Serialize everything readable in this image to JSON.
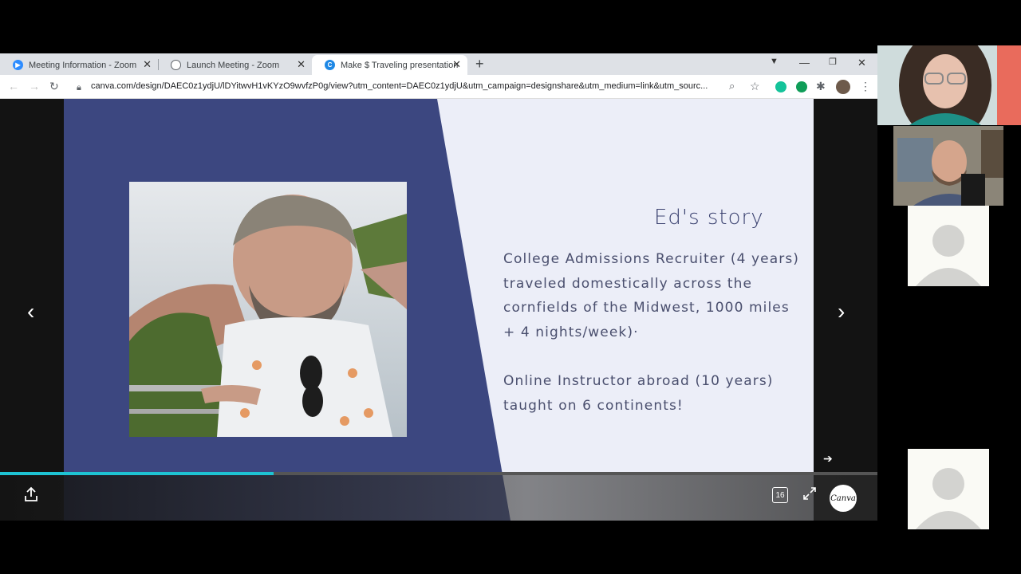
{
  "browser": {
    "tabs": [
      {
        "title": "Meeting Information - Zoom",
        "icon": "zoom-icon",
        "color": "#2d8cff"
      },
      {
        "title": "Launch Meeting - Zoom",
        "icon": "globe-icon",
        "color": "#5f6368"
      },
      {
        "title": "Make $ Traveling presentation",
        "icon": "canva-icon",
        "color": "#1e88e5",
        "active": true
      }
    ],
    "url": "canva.com/design/DAEC0z1ydjU/lDYitwvH1vKYzO9wvfzP0g/view?utm_content=DAEC0z1ydjU&utm_campaign=designshare&utm_medium=link&utm_sourc..."
  },
  "slide": {
    "title": "Ed's story",
    "paragraphs": [
      [
        "College Admissions Recruiter (4 years)",
        "traveled domestically across the",
        "cornfields of the Midwest, 1000 miles",
        "+ 4 nights/week)·"
      ],
      [
        "Online Instructor abroad (10 years)",
        " taught on 6 continents!"
      ]
    ],
    "progress_fraction": 0.312
  },
  "controls": {
    "page_badge": "16",
    "canva_logo": "Canva"
  },
  "colors": {
    "slide_bg": "#eceef8",
    "accent_navy": "#3c4780",
    "progress": "#1ec3d3"
  }
}
